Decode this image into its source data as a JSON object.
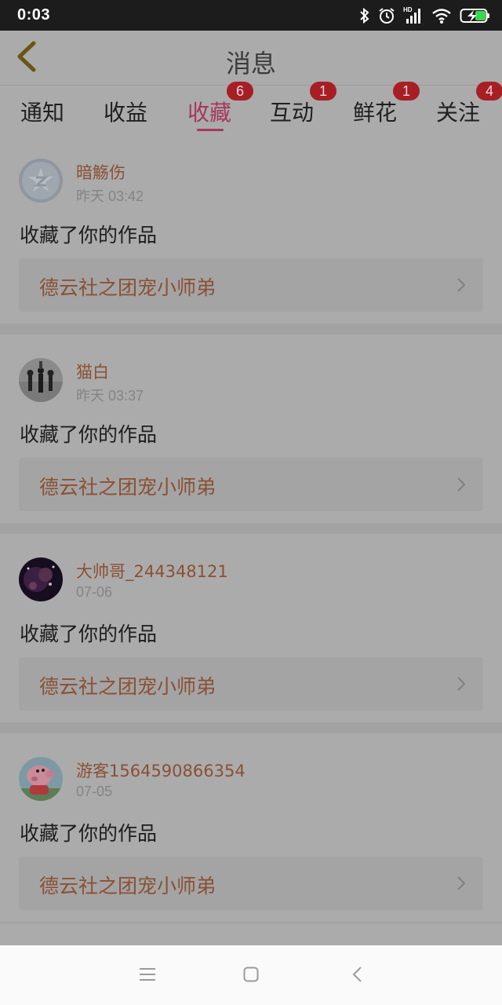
{
  "status_bar": {
    "time": "0:03",
    "network_label": "HD"
  },
  "header": {
    "title": "消息"
  },
  "tabs": [
    {
      "label": "通知",
      "badge": ""
    },
    {
      "label": "收益",
      "badge": ""
    },
    {
      "label": "收藏",
      "badge": "6",
      "active": true
    },
    {
      "label": "互动",
      "badge": "1"
    },
    {
      "label": "鲜花",
      "badge": "1"
    },
    {
      "label": "关注",
      "badge": "4"
    }
  ],
  "items": [
    {
      "username": "暗觞伤",
      "time": "昨天 03:42",
      "action": "收藏了你的作品",
      "work_title": "德云社之团宠小师弟"
    },
    {
      "username": "猫白",
      "time": "昨天 03:37",
      "action": "收藏了你的作品",
      "work_title": "德云社之团宠小师弟"
    },
    {
      "username": "大帅哥_244348121",
      "time": "07-06",
      "action": "收藏了你的作品",
      "work_title": "德云社之团宠小师弟"
    },
    {
      "username": "游客1564590866354",
      "time": "07-05",
      "action": "收藏了你的作品",
      "work_title": "德云社之团宠小师弟"
    }
  ],
  "colors": {
    "overlay": "#ababab",
    "accent": "#a8365e",
    "badge": "#a81e25",
    "link": "#8a5034"
  }
}
